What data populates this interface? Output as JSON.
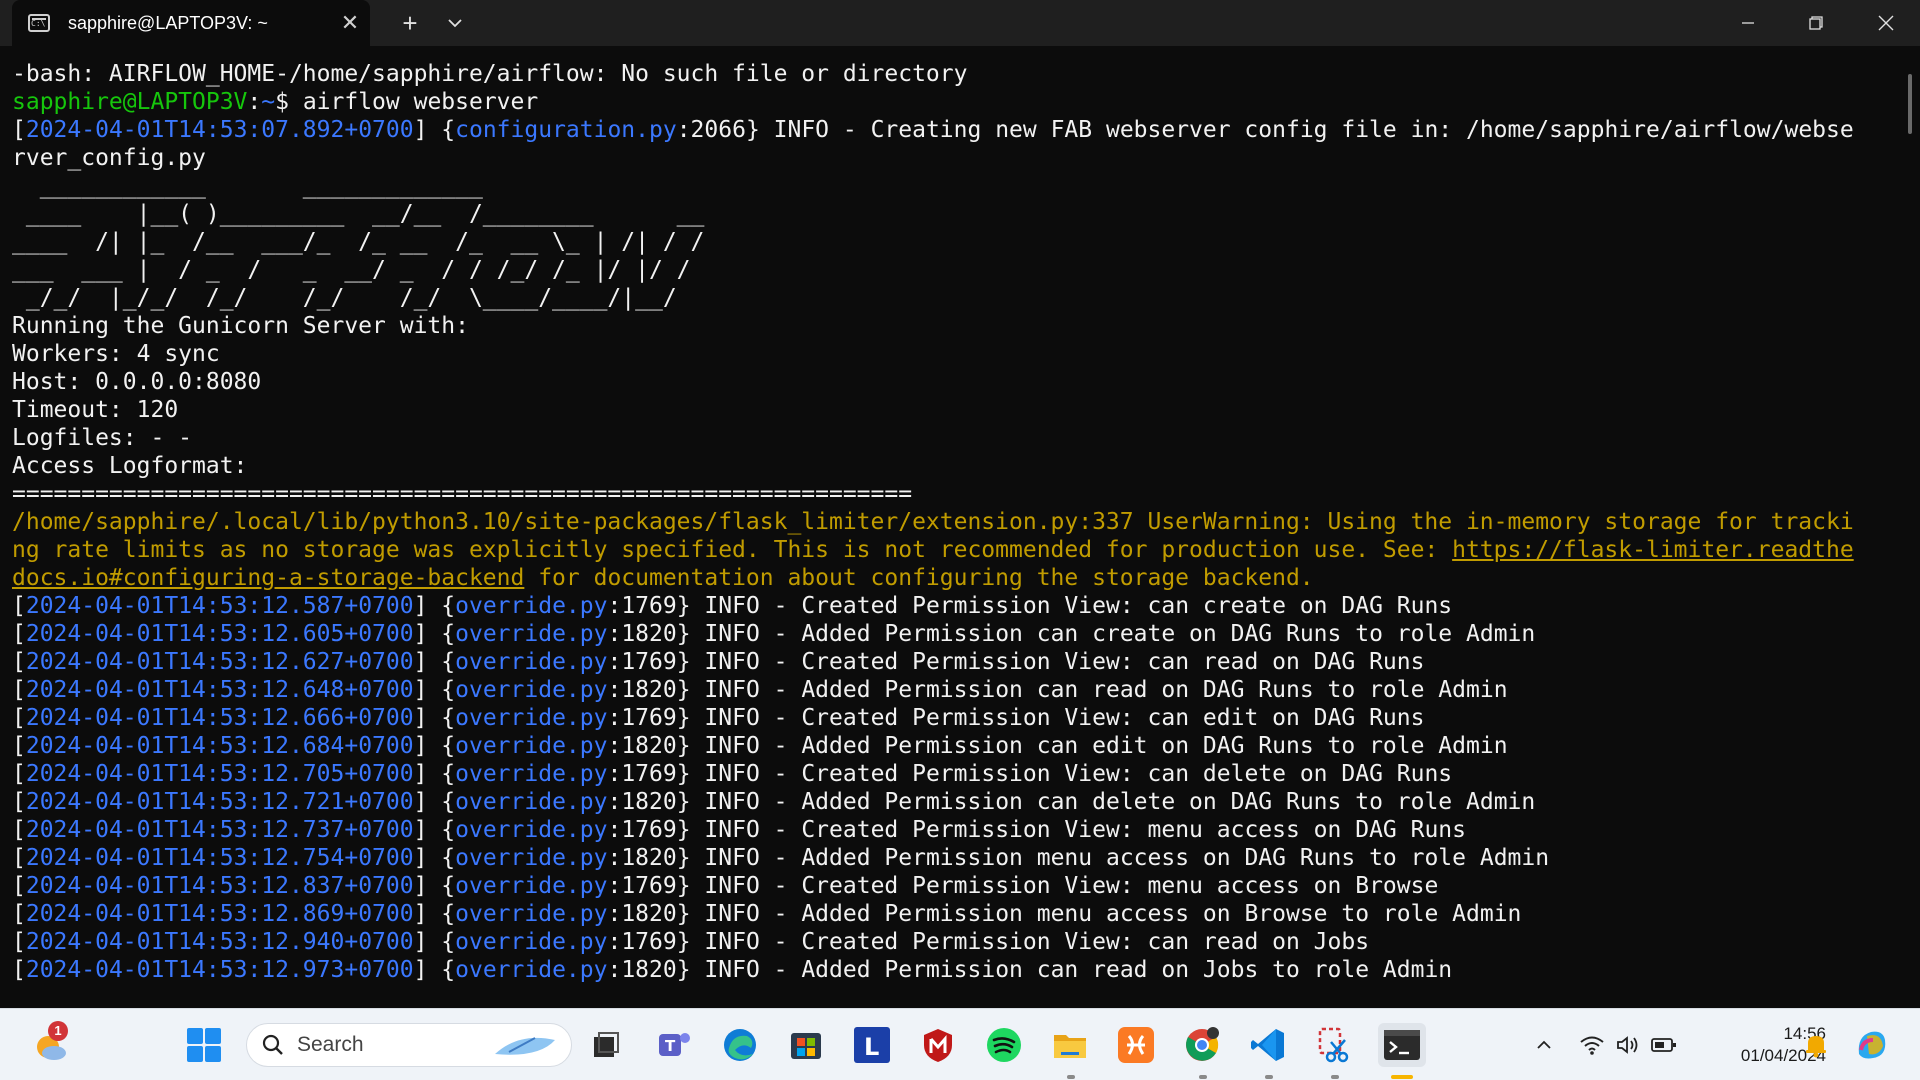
{
  "window": {
    "tab_title": "sapphire@LAPTOP3V: ~",
    "new_tab_label": "+"
  },
  "terminal": {
    "lines": [
      [
        {
          "t": "-bash: AIRFLOW_HOME-/home/sapphire/airflow: No such file or directory",
          "c": "white"
        }
      ],
      [
        {
          "t": "sapphire@LAPTOP3V",
          "c": "green"
        },
        {
          "t": ":",
          "c": "white"
        },
        {
          "t": "~",
          "c": "blue"
        },
        {
          "t": "$ airflow webserver",
          "c": "white"
        }
      ],
      [
        {
          "t": "[",
          "c": "white"
        },
        {
          "t": "2024-04-01T14:53:07.892+0700",
          "c": "blue"
        },
        {
          "t": "] {",
          "c": "white"
        },
        {
          "t": "configuration.py",
          "c": "blue"
        },
        {
          "t": ":2066} INFO - Creating new FAB webserver config file in: /home/sapphire/airflow/webse",
          "c": "white"
        }
      ],
      [
        {
          "t": "rver_config.py",
          "c": "white"
        }
      ],
      [
        {
          "t": "  ____________       _____________",
          "c": "white"
        }
      ],
      [
        {
          "t": " ____    |__( )_________  __/__  /________      __",
          "c": "white"
        }
      ],
      [
        {
          "t": "____  /| |_  /__  ___/_  /_ __  /_  __ \\_ | /| / /",
          "c": "white"
        }
      ],
      [
        {
          "t": "___  ___ |  / _  /   _  __/ _  / / /_/ /_ |/ |/ /",
          "c": "white"
        }
      ],
      [
        {
          "t": " _/_/  |_/_/  /_/    /_/    /_/  \\____/____/|__/",
          "c": "white"
        }
      ],
      [
        {
          "t": "Running the Gunicorn Server with:",
          "c": "white"
        }
      ],
      [
        {
          "t": "Workers: 4 sync",
          "c": "white"
        }
      ],
      [
        {
          "t": "Host: 0.0.0.0:8080",
          "c": "white"
        }
      ],
      [
        {
          "t": "Timeout: 120",
          "c": "white"
        }
      ],
      [
        {
          "t": "Logfiles: - -",
          "c": "white"
        }
      ],
      [
        {
          "t": "Access Logformat:",
          "c": "white"
        }
      ],
      [
        {
          "t": "=================================================================",
          "c": "white"
        }
      ],
      [
        {
          "t": "/home/sapphire/.local/lib/python3.10/site-packages/flask_limiter/extension.py:337 UserWarning",
          "c": "yellow"
        },
        {
          "t": ": Using the in-memory storage for tracki",
          "c": "yellow"
        }
      ],
      [
        {
          "t": "ng rate limits as no storage was explicitly specified. This is not recommended for production use. See: ",
          "c": "yellow"
        },
        {
          "t": "https://flask-limiter.readthe",
          "c": "yellow-u"
        }
      ],
      [
        {
          "t": "docs.io#configuring-a-storage-backend",
          "c": "yellow-u"
        },
        {
          "t": " for documentation about configuring the storage backend.",
          "c": "yellow"
        }
      ],
      [
        {
          "t": "[",
          "c": "white"
        },
        {
          "t": "2024-04-01T14:53:12.587+0700",
          "c": "blue"
        },
        {
          "t": "] {",
          "c": "white"
        },
        {
          "t": "override.py",
          "c": "blue"
        },
        {
          "t": ":1769} INFO - Created Permission View: can create on DAG Runs",
          "c": "white"
        }
      ],
      [
        {
          "t": "[",
          "c": "white"
        },
        {
          "t": "2024-04-01T14:53:12.605+0700",
          "c": "blue"
        },
        {
          "t": "] {",
          "c": "white"
        },
        {
          "t": "override.py",
          "c": "blue"
        },
        {
          "t": ":1820} INFO - Added Permission can create on DAG Runs to role Admin",
          "c": "white"
        }
      ],
      [
        {
          "t": "[",
          "c": "white"
        },
        {
          "t": "2024-04-01T14:53:12.627+0700",
          "c": "blue"
        },
        {
          "t": "] {",
          "c": "white"
        },
        {
          "t": "override.py",
          "c": "blue"
        },
        {
          "t": ":1769} INFO - Created Permission View: can read on DAG Runs",
          "c": "white"
        }
      ],
      [
        {
          "t": "[",
          "c": "white"
        },
        {
          "t": "2024-04-01T14:53:12.648+0700",
          "c": "blue"
        },
        {
          "t": "] {",
          "c": "white"
        },
        {
          "t": "override.py",
          "c": "blue"
        },
        {
          "t": ":1820} INFO - Added Permission can read on DAG Runs to role Admin",
          "c": "white"
        }
      ],
      [
        {
          "t": "[",
          "c": "white"
        },
        {
          "t": "2024-04-01T14:53:12.666+0700",
          "c": "blue"
        },
        {
          "t": "] {",
          "c": "white"
        },
        {
          "t": "override.py",
          "c": "blue"
        },
        {
          "t": ":1769} INFO - Created Permission View: can edit on DAG Runs",
          "c": "white"
        }
      ],
      [
        {
          "t": "[",
          "c": "white"
        },
        {
          "t": "2024-04-01T14:53:12.684+0700",
          "c": "blue"
        },
        {
          "t": "] {",
          "c": "white"
        },
        {
          "t": "override.py",
          "c": "blue"
        },
        {
          "t": ":1820} INFO - Added Permission can edit on DAG Runs to role Admin",
          "c": "white"
        }
      ],
      [
        {
          "t": "[",
          "c": "white"
        },
        {
          "t": "2024-04-01T14:53:12.705+0700",
          "c": "blue"
        },
        {
          "t": "] {",
          "c": "white"
        },
        {
          "t": "override.py",
          "c": "blue"
        },
        {
          "t": ":1769} INFO - Created Permission View: can delete on DAG Runs",
          "c": "white"
        }
      ],
      [
        {
          "t": "[",
          "c": "white"
        },
        {
          "t": "2024-04-01T14:53:12.721+0700",
          "c": "blue"
        },
        {
          "t": "] {",
          "c": "white"
        },
        {
          "t": "override.py",
          "c": "blue"
        },
        {
          "t": ":1820} INFO - Added Permission can delete on DAG Runs to role Admin",
          "c": "white"
        }
      ],
      [
        {
          "t": "[",
          "c": "white"
        },
        {
          "t": "2024-04-01T14:53:12.737+0700",
          "c": "blue"
        },
        {
          "t": "] {",
          "c": "white"
        },
        {
          "t": "override.py",
          "c": "blue"
        },
        {
          "t": ":1769} INFO - Created Permission View: menu access on DAG Runs",
          "c": "white"
        }
      ],
      [
        {
          "t": "[",
          "c": "white"
        },
        {
          "t": "2024-04-01T14:53:12.754+0700",
          "c": "blue"
        },
        {
          "t": "] {",
          "c": "white"
        },
        {
          "t": "override.py",
          "c": "blue"
        },
        {
          "t": ":1820} INFO - Added Permission menu access on DAG Runs to role Admin",
          "c": "white"
        }
      ],
      [
        {
          "t": "[",
          "c": "white"
        },
        {
          "t": "2024-04-01T14:53:12.837+0700",
          "c": "blue"
        },
        {
          "t": "] {",
          "c": "white"
        },
        {
          "t": "override.py",
          "c": "blue"
        },
        {
          "t": ":1769} INFO - Created Permission View: menu access on Browse",
          "c": "white"
        }
      ],
      [
        {
          "t": "[",
          "c": "white"
        },
        {
          "t": "2024-04-01T14:53:12.869+0700",
          "c": "blue"
        },
        {
          "t": "] {",
          "c": "white"
        },
        {
          "t": "override.py",
          "c": "blue"
        },
        {
          "t": ":1820} INFO - Added Permission menu access on Browse to role Admin",
          "c": "white"
        }
      ],
      [
        {
          "t": "[",
          "c": "white"
        },
        {
          "t": "2024-04-01T14:53:12.940+0700",
          "c": "blue"
        },
        {
          "t": "] {",
          "c": "white"
        },
        {
          "t": "override.py",
          "c": "blue"
        },
        {
          "t": ":1769} INFO - Created Permission View: can read on Jobs",
          "c": "white"
        }
      ],
      [
        {
          "t": "[",
          "c": "white"
        },
        {
          "t": "2024-04-01T14:53:12.973+0700",
          "c": "blue"
        },
        {
          "t": "] {",
          "c": "white"
        },
        {
          "t": "override.py",
          "c": "blue"
        },
        {
          "t": ":1820} INFO - Added Permission can read on Jobs to role Admin",
          "c": "white"
        }
      ]
    ]
  },
  "taskbar": {
    "search_label": "Search",
    "notification_count": "1",
    "launcher_letter": "L",
    "time": "14:56",
    "date": "01/04/2024",
    "accent": "#f7b500",
    "icons": [
      "weather-icon",
      "start-icon",
      "task-view-icon",
      "teams-icon",
      "edge-icon",
      "store-icon",
      "l-app-icon",
      "mcafee-icon",
      "spotify-icon",
      "file-explorer-icon",
      "xampp-icon",
      "chrome-icon",
      "vscode-icon",
      "snipping-tool-icon",
      "terminal-icon",
      "chevron-up-icon",
      "wifi-icon",
      "volume-icon",
      "battery-icon",
      "bell-icon",
      "copilot-icon"
    ]
  }
}
